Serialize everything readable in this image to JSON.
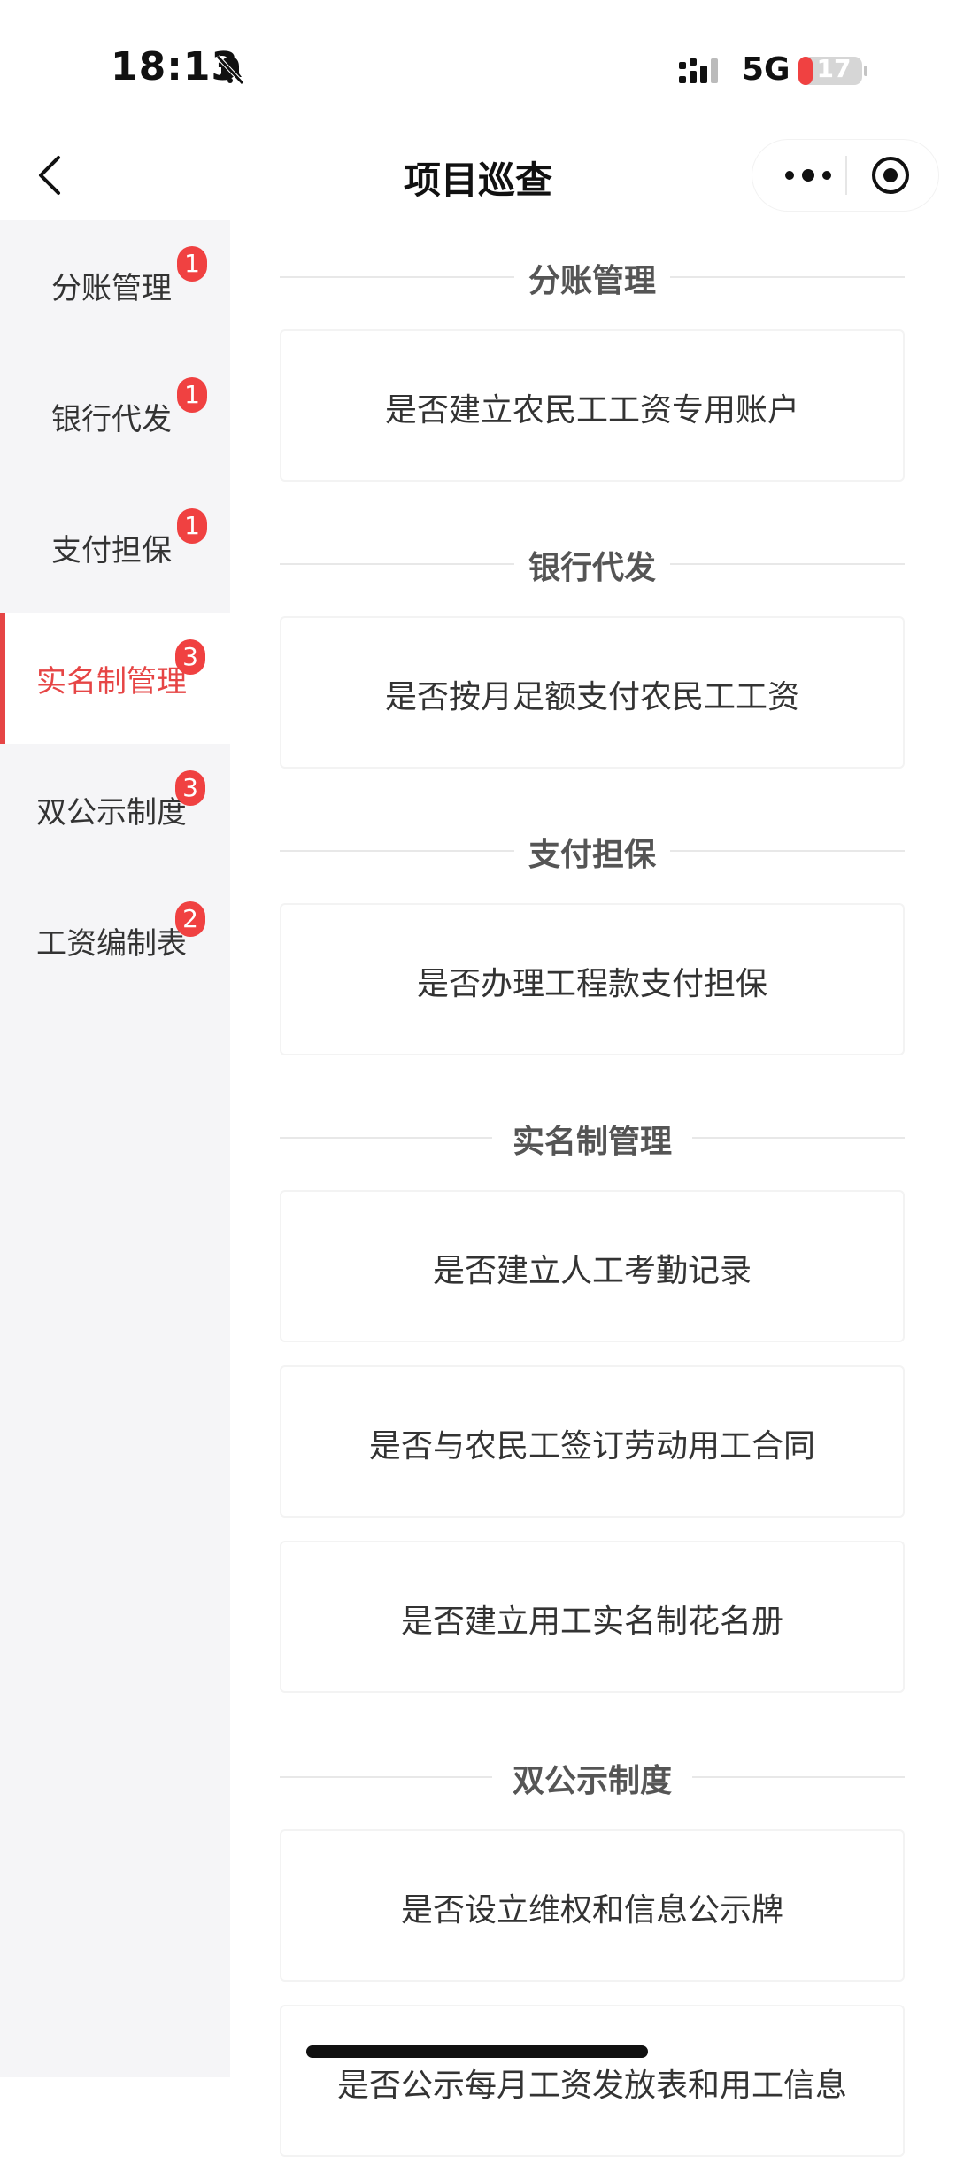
{
  "status_bar": {
    "time": "18:13",
    "network": "5G",
    "battery": "17",
    "battery_color": "#f04141"
  },
  "nav": {
    "title": "项目巡查",
    "back_icon": "chevron-left-icon",
    "more_icon": "more-dots-icon",
    "close_icon": "target-close-icon"
  },
  "sidebar": {
    "items": [
      {
        "label": "分账管理",
        "badge": "1"
      },
      {
        "label": "银行代发",
        "badge": "1"
      },
      {
        "label": "支付担保",
        "badge": "1"
      },
      {
        "label": "实名制管理",
        "badge": "3"
      },
      {
        "label": "双公示制度",
        "badge": "3"
      },
      {
        "label": "工资编制表",
        "badge": "2"
      }
    ],
    "active_index": 3,
    "accent_color": "#e64545"
  },
  "sections": [
    {
      "title": "分账管理",
      "items": [
        "是否建立农民工工资专用账户"
      ]
    },
    {
      "title": "银行代发",
      "items": [
        "是否按月足额支付农民工工资"
      ]
    },
    {
      "title": "支付担保",
      "items": [
        "是否办理工程款支付担保"
      ]
    },
    {
      "title": "实名制管理",
      "items": [
        "是否建立人工考勤记录",
        "是否与农民工签订劳动用工合同",
        "是否建立用工实名制花名册"
      ]
    },
    {
      "title": "双公示制度",
      "items": [
        "是否设立维权和信息公示牌",
        "是否公示每月工资发放表和用工信息"
      ]
    }
  ]
}
